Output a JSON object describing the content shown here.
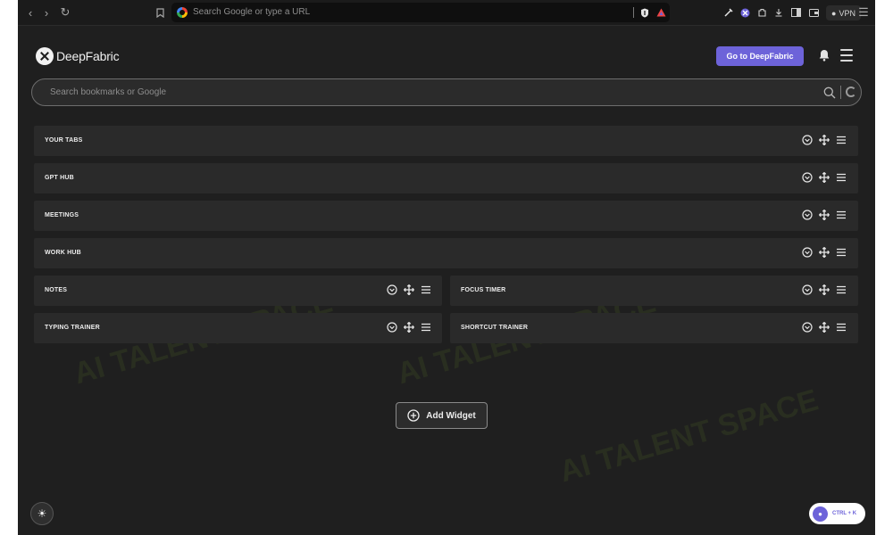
{
  "browser": {
    "omnibox_placeholder": "Search Google or type a URL",
    "vpn_label": "VPN"
  },
  "header": {
    "logo_text": "DeepFabric",
    "cta_label": "Go to DeepFabric"
  },
  "search": {
    "placeholder": "Search bookmarks or Google"
  },
  "widgets": [
    {
      "title": "YOUR TABS"
    },
    {
      "title": "GPT HUB"
    },
    {
      "title": "MEETINGS"
    },
    {
      "title": "WORK HUB"
    },
    {
      "title": "NOTES"
    },
    {
      "title": "FOCUS TIMER"
    },
    {
      "title": "TYPING TRAINER"
    },
    {
      "title": "SHORTCUT TRAINER"
    }
  ],
  "add_widget_label": "Add Widget",
  "shortcut_label": "CTRL + K",
  "watermark_text": "AI TALENT SPACE",
  "colors": {
    "background": "#1f1f1f",
    "widget": "#2a2a2a",
    "accent": "#6d63d9"
  }
}
